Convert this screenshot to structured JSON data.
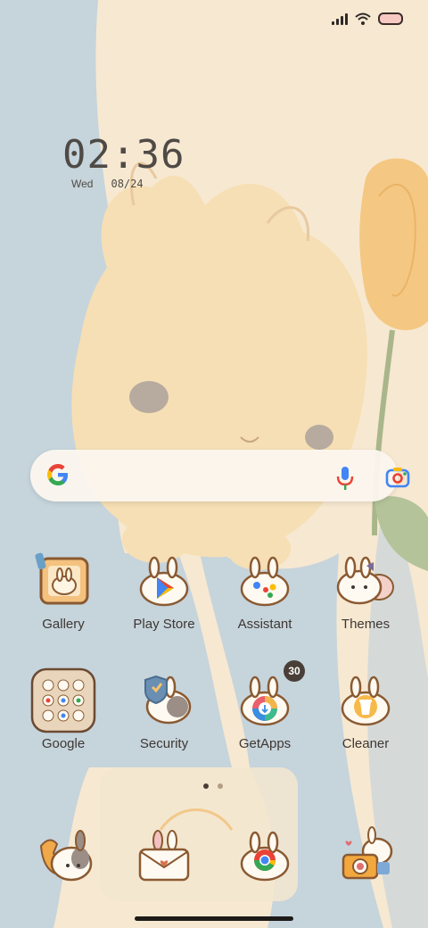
{
  "status_bar": {
    "signal_icon": "signal-icon",
    "wifi_icon": "wifi-icon",
    "battery_icon": "battery-icon"
  },
  "clock": {
    "time": "02:36",
    "day": "Wed",
    "date": "08/24"
  },
  "search_widget": {
    "logo": "google-g-icon",
    "mic_icon": "mic-icon",
    "lens_icon": "lens-icon"
  },
  "apps_row1": [
    {
      "label": "Gallery",
      "icon": "gallery-icon"
    },
    {
      "label": "Play Store",
      "icon": "play-store-icon"
    },
    {
      "label": "Assistant",
      "icon": "assistant-icon"
    },
    {
      "label": "Themes",
      "icon": "themes-icon"
    }
  ],
  "apps_row2": [
    {
      "label": "Google",
      "icon": "google-folder-icon"
    },
    {
      "label": "Security",
      "icon": "security-icon"
    },
    {
      "label": "GetApps",
      "icon": "getapps-icon",
      "badge": "30"
    },
    {
      "label": "Cleaner",
      "icon": "cleaner-icon"
    }
  ],
  "dock": [
    {
      "icon": "phone-icon"
    },
    {
      "icon": "messages-icon"
    },
    {
      "icon": "chrome-icon"
    },
    {
      "icon": "camera-icon"
    }
  ],
  "page_indicator": {
    "pages": 2,
    "current": 1
  },
  "colors": {
    "wallpaper_cream": "#f7e8d1",
    "wallpaper_blue": "#c6d4dc",
    "bunny": "#f6dfb4",
    "outline": "#8a5a32"
  }
}
